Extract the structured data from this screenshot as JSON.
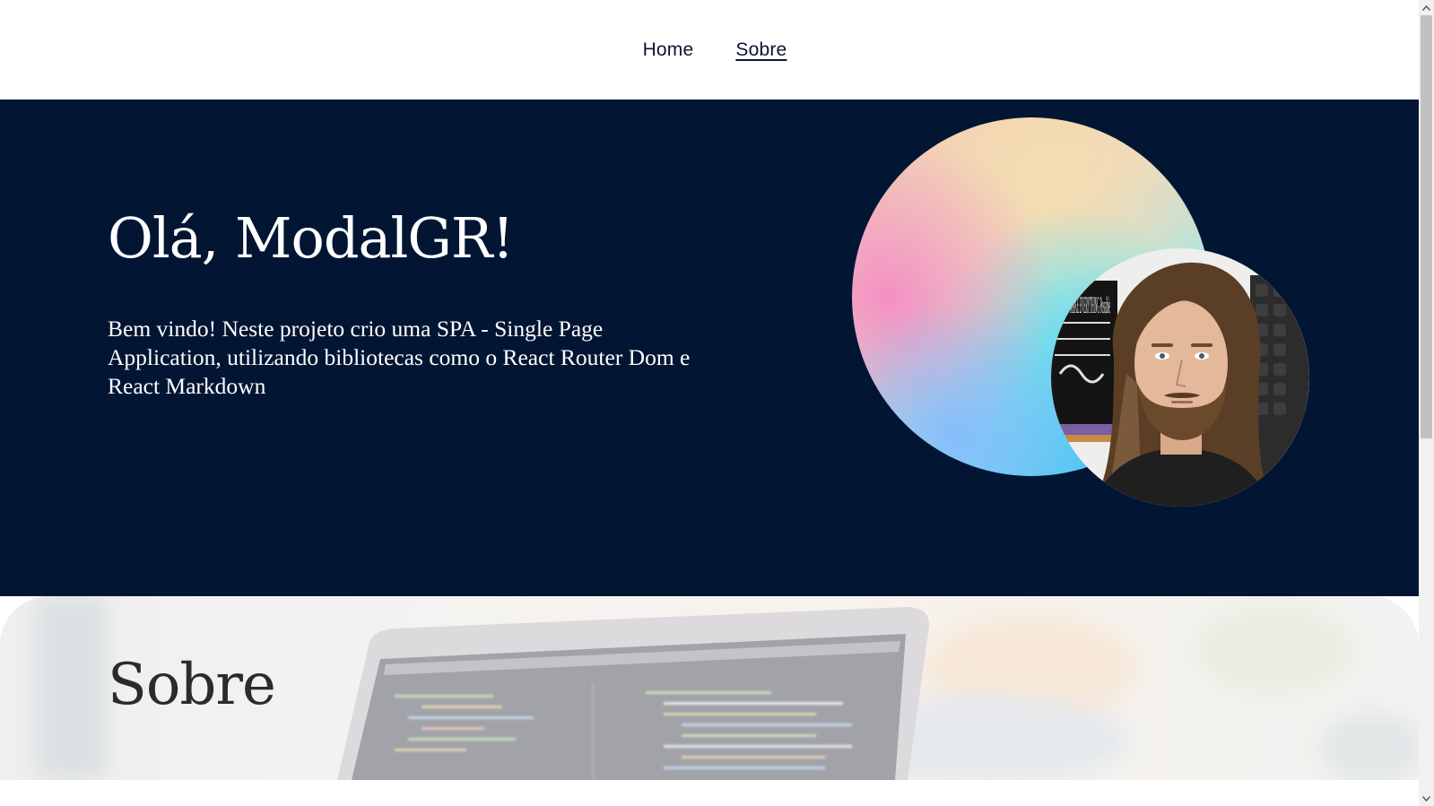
{
  "nav": {
    "items": [
      {
        "label": "Home",
        "active": false
      },
      {
        "label": "Sobre",
        "active": true
      }
    ]
  },
  "hero": {
    "title": "Olá, ModalGR!",
    "text": "Bem vindo! Neste projeto crio uma SPA - Single Page Application, utilizando bibliotecas como o React Router Dom e React Markdown",
    "background_color": "#021634"
  },
  "sobre": {
    "title": "Sobre"
  },
  "avatar": {
    "poster_text": "Co MAKE EVERYTHING Possible"
  },
  "icons": [
    "scroll-up-arrow-icon",
    "scroll-down-arrow-icon"
  ]
}
